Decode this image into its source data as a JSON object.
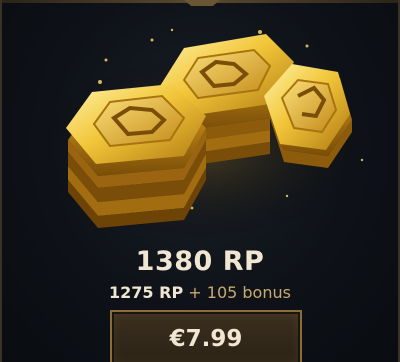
{
  "bundle": {
    "total": "1380 RP",
    "base": "1275 RP",
    "bonus": "+ 105 bonus",
    "price": "€7.99"
  },
  "icons": {
    "currency": "riot-points-coins-icon"
  },
  "colors": {
    "gold": "#c8aa6e",
    "text": "#f0e6d2",
    "button_border": "#8a6d3b"
  }
}
